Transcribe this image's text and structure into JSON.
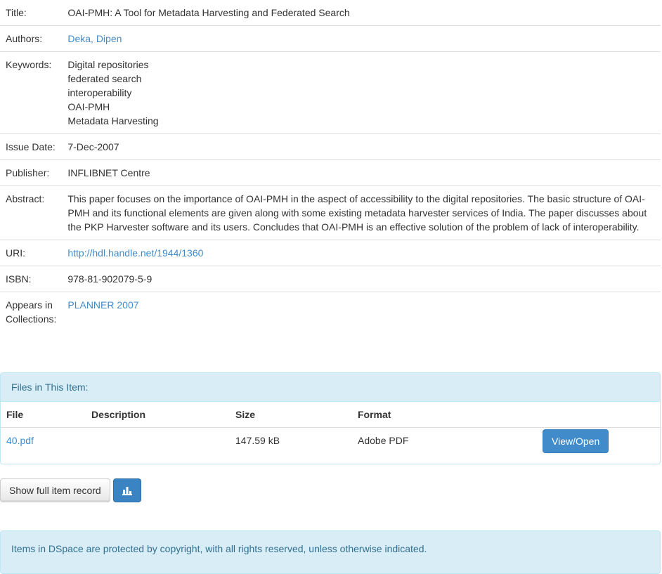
{
  "metadata": {
    "title": {
      "label": "Title:",
      "value": "OAI-PMH: A Tool for Metadata Harvesting and Federated Search"
    },
    "authors": {
      "label": "Authors:",
      "value": "Deka, Dipen"
    },
    "keywords": {
      "label": "Keywords:",
      "values": [
        "Digital repositories",
        "federated search",
        "interoperability",
        "OAI-PMH",
        "Metadata Harvesting"
      ]
    },
    "issue_date": {
      "label": "Issue Date:",
      "value": "7-Dec-2007"
    },
    "publisher": {
      "label": "Publisher:",
      "value": "INFLIBNET Centre"
    },
    "abstract": {
      "label": "Abstract:",
      "value": "This paper focuses on the importance of OAI-PMH in the aspect of accessibility to the digital repositories. The basic structure of OAI-PMH and its functional elements are given along with some existing metadata harvester services of India. The paper discusses about the PKP Harvester software and its users. Concludes that OAI-PMH is an effective solution of the problem of lack of interoperability."
    },
    "uri": {
      "label": "URI:",
      "value": "http://hdl.handle.net/1944/1360"
    },
    "isbn": {
      "label": "ISBN:",
      "value": "978-81-902079-5-9"
    },
    "collections": {
      "label": "Appears in Collections:",
      "value": "PLANNER 2007"
    }
  },
  "files_panel": {
    "heading": "Files in This Item:",
    "columns": [
      "File",
      "Description",
      "Size",
      "Format"
    ],
    "rows": [
      {
        "file": "40.pdf",
        "description": "",
        "size": "147.59 kB",
        "format": "Adobe PDF",
        "action": "View/Open"
      }
    ]
  },
  "actions": {
    "full_record_label": "Show full item record",
    "stats_icon": "bar-chart-icon"
  },
  "footer": {
    "notice": "Items in DSpace are protected by copyright, with all rights reserved, unless otherwise indicated."
  },
  "colors": {
    "link": "#428bca",
    "info_bg": "#d9edf7",
    "info_text": "#31708f",
    "primary": "#428bca"
  }
}
